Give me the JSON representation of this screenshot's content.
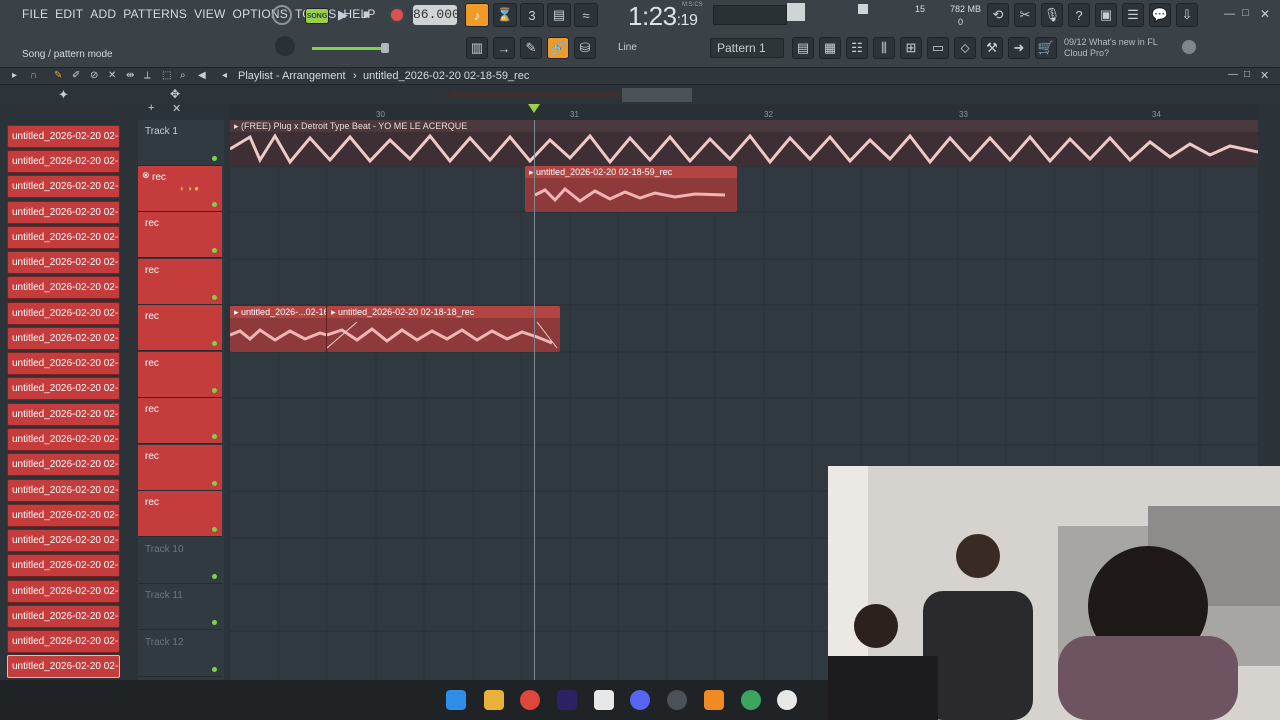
{
  "menu": [
    "FILE",
    "EDIT",
    "ADD",
    "PATTERNS",
    "VIEW",
    "OPTIONS",
    "TOOLS",
    "HELP"
  ],
  "hint": "Song / pattern mode",
  "song_mode_label": "SONG",
  "tempo": "86.000",
  "time": {
    "main": "1:23",
    "sub": ":19",
    "label": "M:S:CS"
  },
  "cpu": {
    "value": "15",
    "memory": "782 MB",
    "voices": "0"
  },
  "snap": "Line",
  "pattern": "Pattern 1",
  "news": {
    "date": "09/12",
    "line1": "What's new in FL",
    "line2": "Cloud Pro?"
  },
  "playlist": {
    "title": "Playlist - Arrangement",
    "separator": "›",
    "file": "untitled_2026-02-20 02-18-59_rec"
  },
  "ruler": [
    "30",
    "31",
    "32",
    "33",
    "34"
  ],
  "channels": [
    "untitled_2026-02-20 02-...",
    "untitled_2026-02-20 02-...",
    "untitled_2026-02-20 02-...",
    "untitled_2026-02-20 02-...",
    "untitled_2026-02-20 02-...",
    "untitled_2026-02-20 02-...",
    "untitled_2026-02-20 02-...",
    "untitled_2026-02-20 02-...",
    "untitled_2026-02-20 02-...",
    "untitled_2026-02-20 02-...",
    "untitled_2026-02-20 02-...",
    "untitled_2026-02-20 02-...",
    "untitled_2026-02-20 02-...",
    "untitled_2026-02-20 02-...",
    "untitled_2026-02-20 02-...",
    "untitled_2026-02-20 02-...",
    "untitled_2026-02-20 02-...",
    "untitled_2026-02-20 02-...",
    "untitled_2026-02-20 02-...",
    "untitled_2026-02-20 02-...",
    "untitled_2026-02-20 02-...",
    "untitled_2026-02-20 02-..."
  ],
  "tracks": [
    {
      "label": "Track 1",
      "color": "grey"
    },
    {
      "label": "rec",
      "color": "red"
    },
    {
      "label": "rec",
      "color": "red"
    },
    {
      "label": "rec",
      "color": "red"
    },
    {
      "label": "rec",
      "color": "red"
    },
    {
      "label": "rec",
      "color": "red"
    },
    {
      "label": "rec",
      "color": "red"
    },
    {
      "label": "rec",
      "color": "red"
    },
    {
      "label": "rec",
      "color": "red"
    },
    {
      "label": "Track 10",
      "color": "grey"
    },
    {
      "label": "Track 11",
      "color": "grey"
    },
    {
      "label": "Track 12",
      "color": "grey"
    }
  ],
  "clips": {
    "beat": "(FREE) Plug x Detroit Type Beat - YO ME LE ACERQUE",
    "rec1": "untitled_2026-02-20 02-18-59_rec",
    "rec2a": "untitled_2026-...02-16",
    "rec2b": "untitled_2026-02-20 02-18-18_rec"
  }
}
